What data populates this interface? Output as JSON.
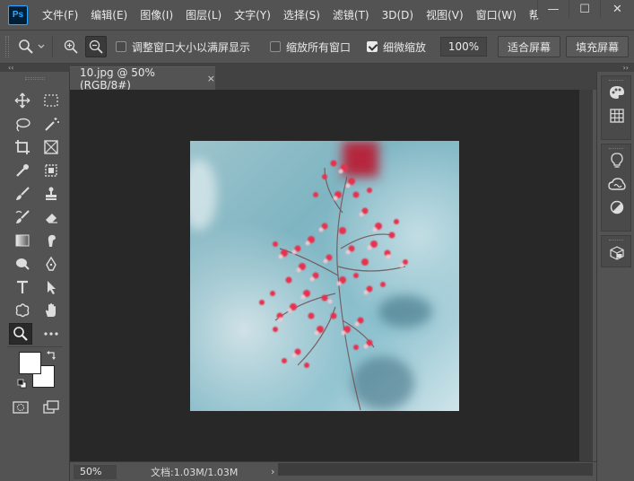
{
  "app": {
    "logo_text": "Ps"
  },
  "menubar": {
    "items": [
      "文件(F)",
      "编辑(E)",
      "图像(I)",
      "图层(L)",
      "文字(Y)",
      "选择(S)",
      "滤镜(T)",
      "3D(D)",
      "视图(V)",
      "窗口(W)",
      "帮"
    ]
  },
  "window_controls": {
    "minimize": "—",
    "maximize": "☐",
    "close": "✕"
  },
  "options_bar": {
    "resize_windows_label": "调整窗口大小以满屏显示",
    "resize_windows_checked": false,
    "zoom_all_windows_label": "缩放所有窗口",
    "zoom_all_windows_checked": false,
    "scrubby_zoom_label": "细微缩放",
    "scrubby_zoom_checked": true,
    "zoom_value": "100%",
    "fit_screen_label": "适合屏幕",
    "fill_screen_label": "填充屏幕"
  },
  "panel_collapse": {
    "left": "‹‹",
    "right": "››"
  },
  "document": {
    "tab_title": "10.jpg @ 50%(RGB/8#)",
    "tab_close": "×"
  },
  "status": {
    "zoom": "50%",
    "doc_size": "文档:1.03M/1.03M",
    "arrow": "›"
  },
  "colors": {
    "foreground": "#ffffff",
    "background": "#ffffff",
    "ui_bg": "#535353",
    "canvas_bg": "#282828",
    "ps_accent": "#31a8ff"
  }
}
